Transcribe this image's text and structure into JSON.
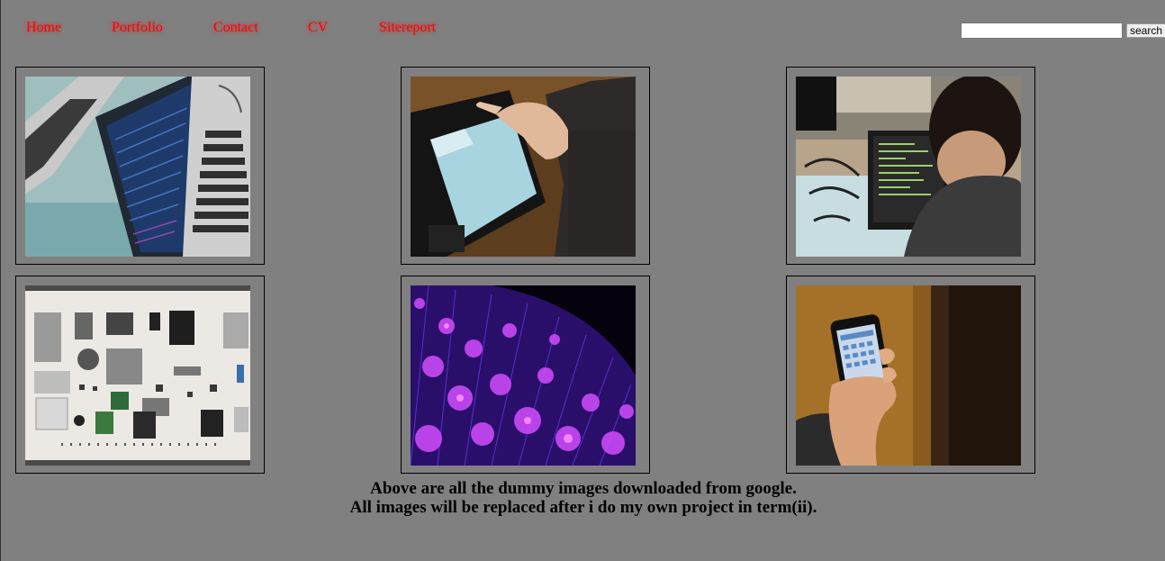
{
  "nav": {
    "items": [
      {
        "label": "Home"
      },
      {
        "label": "Portfolio"
      },
      {
        "label": "Contact"
      },
      {
        "label": "CV"
      },
      {
        "label": "Sitereport"
      }
    ]
  },
  "search": {
    "value": "",
    "button_label": "search"
  },
  "gallery": {
    "images": [
      {
        "subject": "laptop with code on screen"
      },
      {
        "subject": "hand using tablet"
      },
      {
        "subject": "person coding at monitor"
      },
      {
        "subject": "disassembled camera parts"
      },
      {
        "subject": "purple fiber optic lights"
      },
      {
        "subject": "hand holding smartphone"
      }
    ]
  },
  "caption": {
    "line1": "Above are all the dummy images downloaded from google.",
    "line2": "All images will be replaced after i do my own project in term(ii)."
  },
  "colors": {
    "background": "#808080",
    "nav_link": "#ff0000"
  }
}
